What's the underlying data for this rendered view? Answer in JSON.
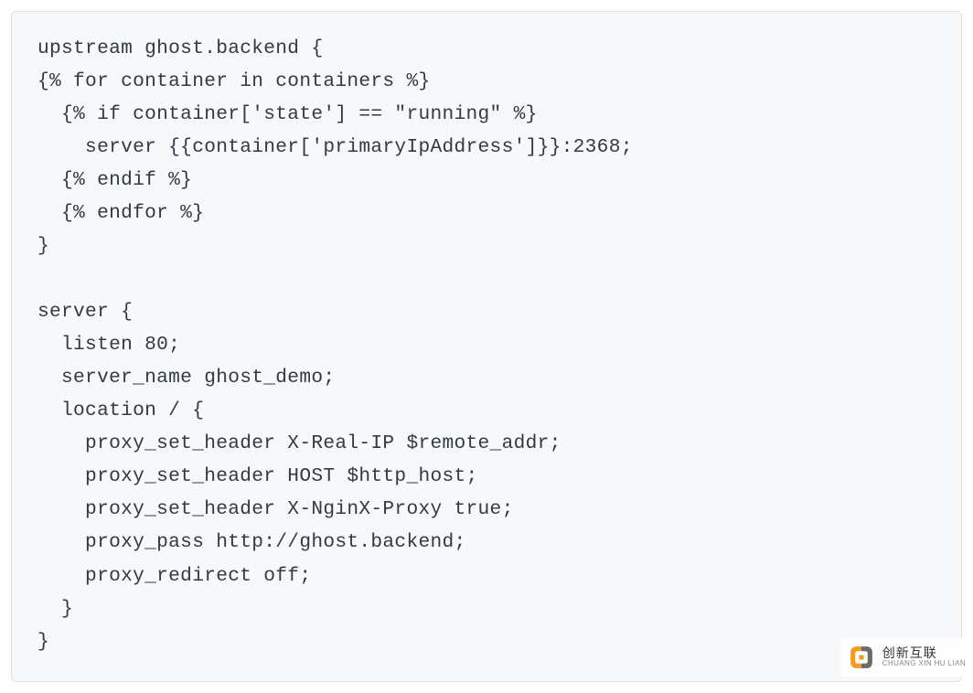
{
  "code": {
    "lines": [
      "upstream ghost.backend {",
      "{% for container in containers %}",
      "  {% if container['state'] == \"running\" %}",
      "    server {{container['primaryIpAddress']}}:2368;",
      "  {% endif %}",
      "  {% endfor %}",
      "}",
      "",
      "server {",
      "  listen 80;",
      "  server_name ghost_demo;",
      "  location / {",
      "    proxy_set_header X-Real-IP $remote_addr;",
      "    proxy_set_header HOST $http_host;",
      "    proxy_set_header X-NginX-Proxy true;",
      "    proxy_pass http://ghost.backend;",
      "    proxy_redirect off;",
      "  }",
      "}"
    ]
  },
  "watermark": {
    "cn": "创新互联",
    "en": "CHUANG XIN HU LIAN"
  }
}
